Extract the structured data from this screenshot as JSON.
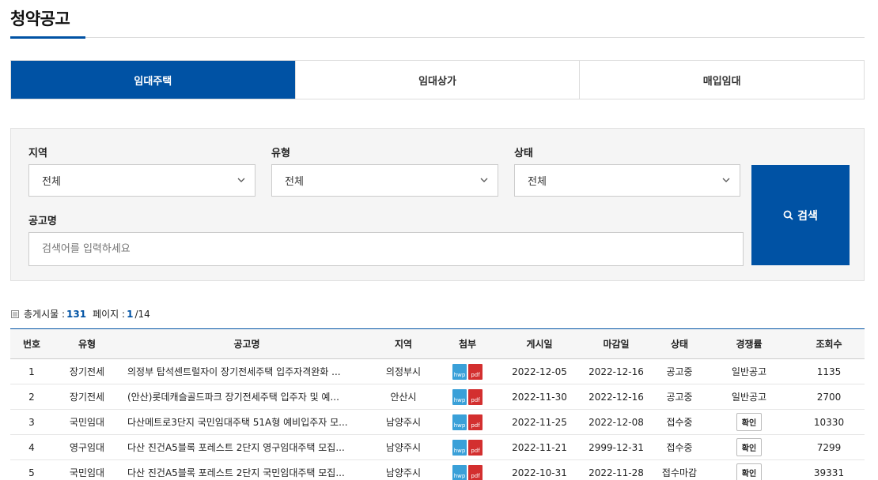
{
  "page": {
    "title": "청약공고"
  },
  "tabs": [
    {
      "label": "임대주택",
      "active": true
    },
    {
      "label": "임대상가",
      "active": false
    },
    {
      "label": "매입임대",
      "active": false
    }
  ],
  "search": {
    "region_label": "지역",
    "region_value": "전체",
    "type_label": "유형",
    "type_value": "전체",
    "status_label": "상태",
    "status_value": "전체",
    "name_label": "공고명",
    "name_placeholder": "검색어를 입력하세요",
    "button_label": "검색"
  },
  "summary": {
    "total_label": "총게시물 :",
    "total_value": "131",
    "page_label": "페이지 :",
    "page_current": "1",
    "page_total": "/14"
  },
  "table": {
    "headers": [
      "번호",
      "유형",
      "공고명",
      "지역",
      "첨부",
      "게시일",
      "마감일",
      "상태",
      "경쟁률",
      "조회수"
    ],
    "rows": [
      {
        "no": "1",
        "type": "장기전세",
        "title": "의정부 탑석센트럴자이 장기전세주택 입주자격완화 ...",
        "region": "의정부시",
        "posted": "2022-12-05",
        "deadline": "2022-12-16",
        "status": "공고중",
        "rate": "일반공고",
        "rate_is_button": false,
        "views": "1135"
      },
      {
        "no": "2",
        "type": "장기전세",
        "title": "(안산)롯데캐슬골드파크 장기전세주택 입주자 및 예...",
        "region": "안산시",
        "posted": "2022-11-30",
        "deadline": "2022-12-16",
        "status": "공고중",
        "rate": "일반공고",
        "rate_is_button": false,
        "views": "2700"
      },
      {
        "no": "3",
        "type": "국민임대",
        "title": "다산메트로3단지 국민임대주택 51A형 예비입주자 모...",
        "region": "남양주시",
        "posted": "2022-11-25",
        "deadline": "2022-12-08",
        "status": "접수중",
        "rate": "확인",
        "rate_is_button": true,
        "views": "10330"
      },
      {
        "no": "4",
        "type": "영구임대",
        "title": "다산 진건A5블록 포레스트 2단지 영구임대주택 모집...",
        "region": "남양주시",
        "posted": "2022-11-21",
        "deadline": "2999-12-31",
        "status": "접수중",
        "rate": "확인",
        "rate_is_button": true,
        "views": "7299"
      },
      {
        "no": "5",
        "type": "국민임대",
        "title": "다산 진건A5블록 포레스트 2단지 국민임대주택 모집...",
        "region": "남양주시",
        "posted": "2022-10-31",
        "deadline": "2022-11-28",
        "status": "접수마감",
        "rate": "확인",
        "rate_is_button": true,
        "views": "39331"
      }
    ],
    "attach_labels": {
      "hwp": "hwp",
      "pdf": "pdf"
    }
  },
  "icons": {
    "list": "list-icon",
    "search": "search-icon",
    "chevron": "chevron-down-icon"
  },
  "colors": {
    "primary": "#0052a4",
    "hwp": "#3aa0d8",
    "pdf": "#d32f2f"
  }
}
